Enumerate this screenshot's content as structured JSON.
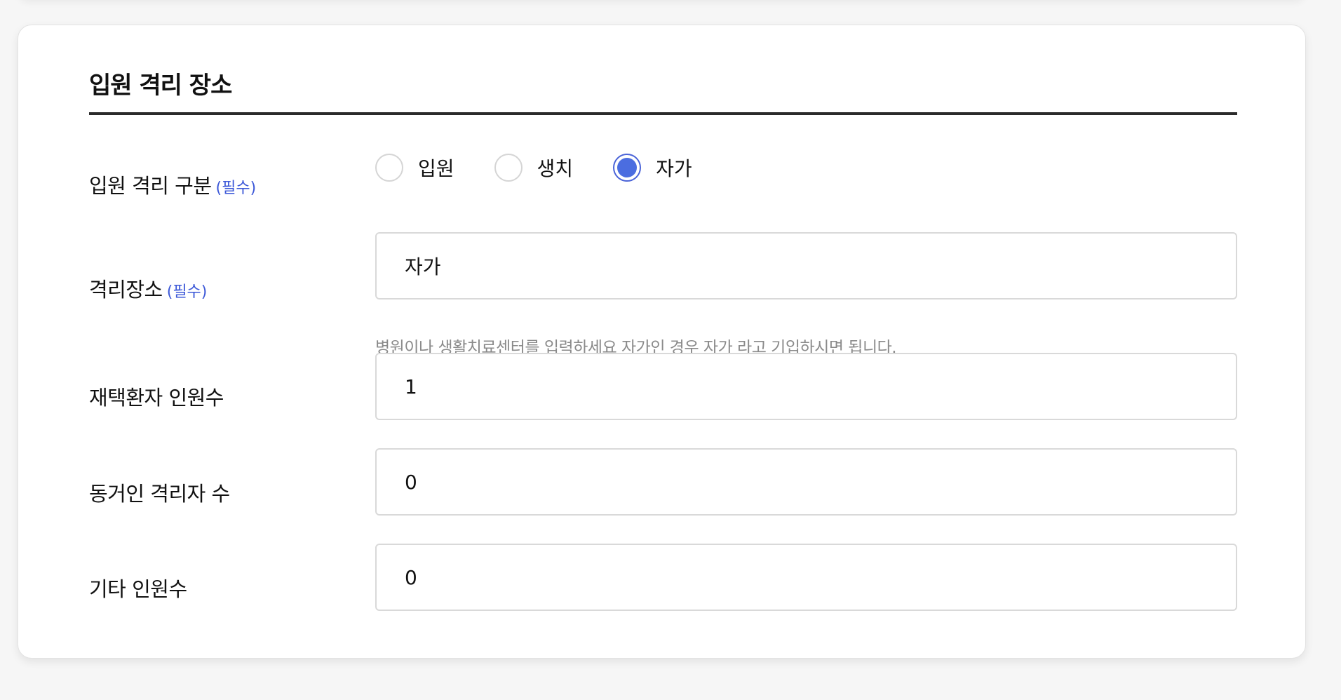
{
  "section": {
    "title": "입원 격리 장소"
  },
  "rows": {
    "type": {
      "label": "입원 격리 구분",
      "required": "(필수)",
      "options": [
        "입원",
        "생치",
        "자가"
      ],
      "selected": "자가"
    },
    "place": {
      "label": "격리장소",
      "required": "(필수)",
      "value": "자가",
      "helper": "병원이나 생활치료센터를 입력하세요 자가인 경우 자가 라고 기입하시면 됩니다."
    },
    "patients": {
      "label": "재택환자 인원수",
      "value": "1"
    },
    "cohabitants": {
      "label": "동거인 격리자 수",
      "value": "0"
    },
    "others": {
      "label": "기타 인원수",
      "value": "0"
    }
  },
  "colors": {
    "accent": "#4b6de0",
    "required": "#3d59d8",
    "helper": "#8a8a8a",
    "rule": "#2b2b2b"
  }
}
